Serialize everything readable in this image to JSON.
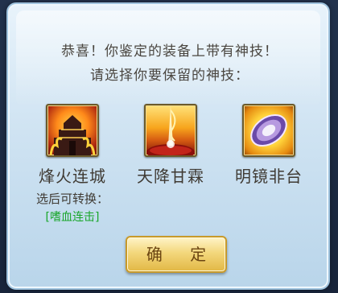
{
  "dialog": {
    "message_line1": "恭喜！你鉴定的装备上带有神技！",
    "message_line2": "请选择你要保留的神技："
  },
  "skills": [
    {
      "name": "烽火连城",
      "icon": "burning-tower-icon",
      "note": "选后可转换：",
      "convert": "[嗜血连击]"
    },
    {
      "name": "天降甘霖",
      "icon": "golden-rain-icon"
    },
    {
      "name": "明镜非台",
      "icon": "mirror-disc-icon"
    }
  ],
  "buttons": {
    "confirm": "确 定"
  },
  "colors": {
    "convert_text": "#19a62a",
    "button_gold": "#f3d77c"
  }
}
